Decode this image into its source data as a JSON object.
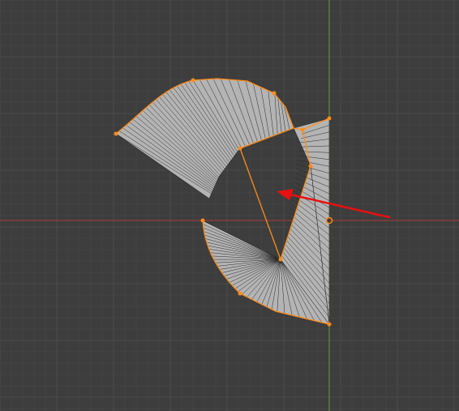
{
  "viewport": {
    "background": "#3d3d3d",
    "grid_minor_color": "#444444",
    "grid_major_color": "#4a4a4a",
    "x_axis_color": "#a83a3a",
    "y_axis_color": "#6a9a3a",
    "mesh_fill": "#b4b4b4",
    "mesh_edge": "#2a2a2a",
    "selection_color": "#ff8c1a",
    "arrow_color": "#e81010"
  },
  "annotation": {
    "icon": "red-arrow-icon"
  }
}
